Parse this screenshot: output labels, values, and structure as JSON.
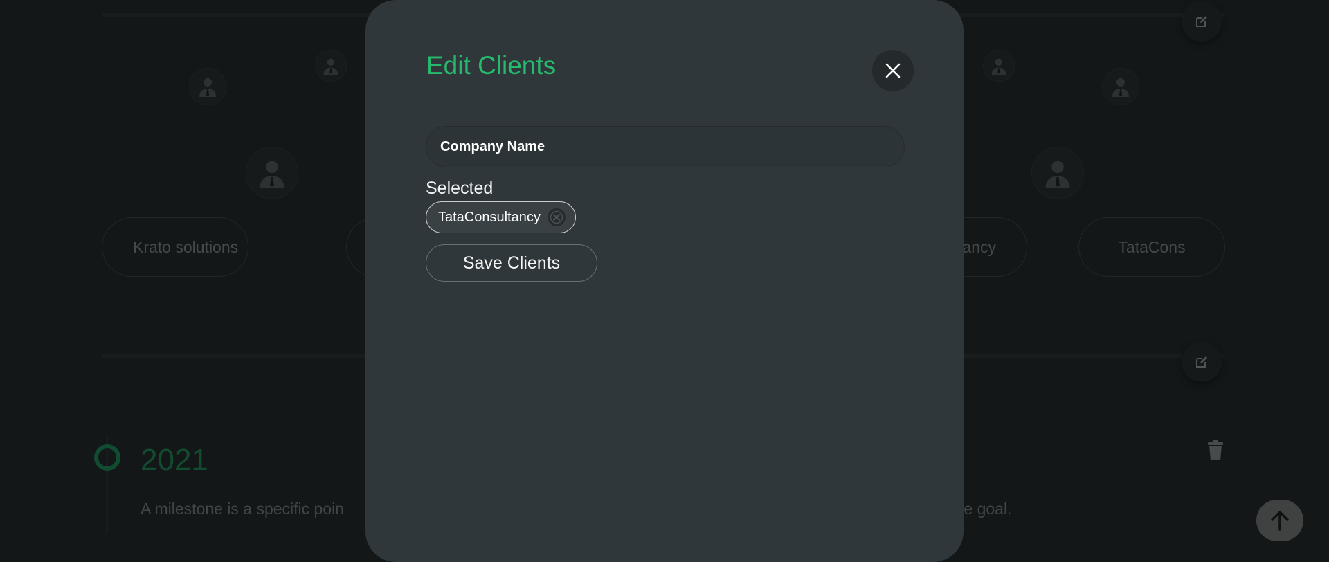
{
  "modal": {
    "title": "Edit Clients",
    "company_input": {
      "placeholder": "Company Name",
      "value": ""
    },
    "selected_label": "Selected",
    "selected_chips": [
      {
        "label": "TataConsultancy"
      }
    ],
    "save_label": "Save Clients",
    "icons": {
      "close": "close-icon",
      "chip_remove": "remove-chip-icon"
    }
  },
  "background": {
    "clients": [
      {
        "label": "Krato solutions"
      },
      {
        "label": "ancy"
      },
      {
        "label": "TataCons"
      }
    ],
    "milestone": {
      "year": "2021",
      "description_left": "A milestone is a specific poin",
      "description_right": "te goal."
    },
    "icons": [
      "edit-icon",
      "trash-icon",
      "arrow-up-icon",
      "avatar-icon"
    ]
  },
  "colors": {
    "accent_green": "#27b96d",
    "modal_bg": "#30373a",
    "page_bg": "#1a1f20"
  }
}
